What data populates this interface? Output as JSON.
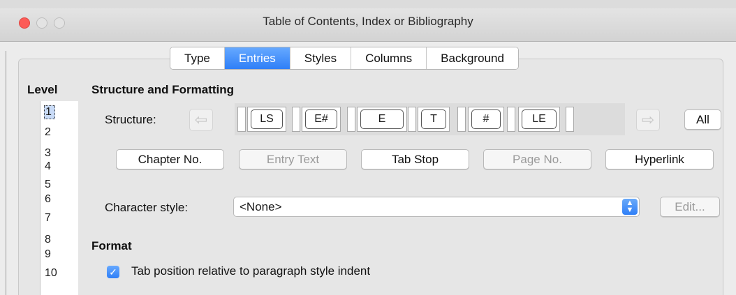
{
  "window": {
    "title": "Table of Contents, Index or Bibliography"
  },
  "tabs": [
    {
      "label": "Type",
      "active": false
    },
    {
      "label": "Entries",
      "active": true
    },
    {
      "label": "Styles",
      "active": false
    },
    {
      "label": "Columns",
      "active": false
    },
    {
      "label": "Background",
      "active": false
    }
  ],
  "level": {
    "heading": "Level",
    "items": [
      "1",
      "2",
      "3",
      "4",
      "5",
      "6",
      "7",
      "8",
      "9",
      "10"
    ],
    "selected": "1"
  },
  "structure_formatting": {
    "heading": "Structure and Formatting",
    "structure_label": "Structure:",
    "tokens": [
      "LS",
      "E#",
      "E",
      "T",
      "#",
      "LE"
    ],
    "all_button": "All",
    "left_arrow_icon": "arrow-left-icon",
    "right_arrow_icon": "arrow-right-icon",
    "insert_buttons": {
      "chapter_no": "Chapter No.",
      "entry_text": "Entry Text",
      "tab_stop": "Tab Stop",
      "page_no": "Page No.",
      "hyperlink": "Hyperlink"
    },
    "character_style_label": "Character style:",
    "character_style_value": "<None>",
    "edit_button": "Edit..."
  },
  "format": {
    "heading": "Format",
    "tab_position_label": "Tab position relative to paragraph style indent",
    "tab_position_checked": true
  },
  "colors": {
    "accent": "#2f7ff7",
    "close": "#fc5b57"
  }
}
